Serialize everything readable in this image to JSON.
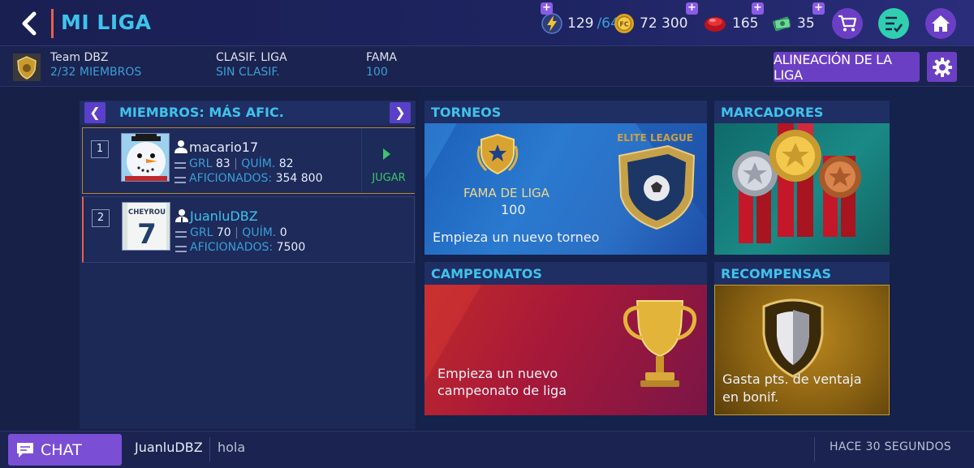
{
  "header": {
    "title": "MI LIGA",
    "back_label": "",
    "currencies": [
      {
        "name": "energy",
        "value": "129",
        "suffix": "/64"
      },
      {
        "name": "coins",
        "value": "72 300"
      },
      {
        "name": "gems",
        "value": "165"
      },
      {
        "name": "cash",
        "value": "35"
      }
    ]
  },
  "league": {
    "team_label": "Team DBZ",
    "members_value": "2/32 MIEMBROS",
    "rank_label": "CLASIF. LIGA",
    "rank_value": "SIN CLASIF.",
    "fame_label": "FAMA",
    "fame_value": "100",
    "lineup_button": "ALINEACIÓN DE LA LIGA"
  },
  "members": {
    "title": "MIEMBROS: MÁS AFIC.",
    "prev": "❮",
    "next": "❯",
    "rows": [
      {
        "rank": "1",
        "name": "macario17",
        "grl_label": "GRL",
        "grl": "83",
        "chem_label": "QUÍM.",
        "chem": "82",
        "fans_label": "AFICIONADOS:",
        "fans": "354 800",
        "play_label": "JUGAR"
      },
      {
        "rank": "2",
        "name": "JuanluDBZ",
        "grl_label": "GRL",
        "grl": "70",
        "chem_label": "QUÍM.",
        "chem": "0",
        "fans_label": "AFICIONADOS:",
        "fans": "7500",
        "jersey_name": "CHEYROU",
        "jersey_number": "7"
      }
    ]
  },
  "tiles": {
    "tournaments": {
      "title": "TORNEOS",
      "fame_label": "FAMA DE LIGA",
      "fame_value": "100",
      "badge_text": "ELITE LEAGUE",
      "cta": "Empieza un nuevo torneo"
    },
    "scoreboards": {
      "title": "MARCADORES"
    },
    "championships": {
      "title": "CAMPEONATOS",
      "cta_line1": "Empieza un nuevo",
      "cta_line2": "campeonato de liga"
    },
    "rewards": {
      "title": "RECOMPENSAS",
      "cta_line1": "Gasta pts. de ventaja",
      "cta_line2": "en bonif."
    }
  },
  "chat": {
    "button": "CHAT",
    "last_user": "JuanluDBZ",
    "last_message": "hola",
    "time": "HACE 30 SEGUNDOS"
  },
  "colors": {
    "accent_cyan": "#3ec3ec",
    "purple": "#7a4fd6",
    "play_green": "#3fc46a",
    "own_marker": "#e8604a"
  }
}
